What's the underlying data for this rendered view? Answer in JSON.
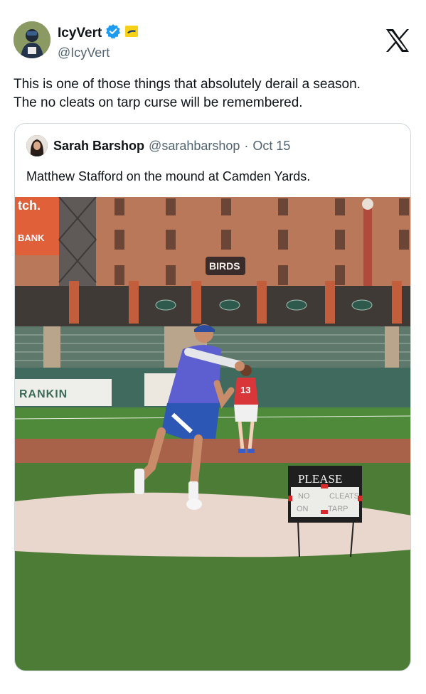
{
  "tweet": {
    "author": {
      "display_name": "IcyVert",
      "handle": "@IcyVert",
      "verified_icon": "verified-badge-icon",
      "affiliate_icon": "affiliate-badge-icon"
    },
    "text_lines": [
      "This is one of those things that absolutely derail a season.",
      "The no cleats on tarp curse will be remembered."
    ],
    "platform_icon": "x-logo-icon"
  },
  "quoted_tweet": {
    "author": {
      "display_name": "Sarah Barshop",
      "handle": "@sarahbarshop",
      "separator": "·",
      "date": "Oct 15"
    },
    "text": "Matthew Stafford on the mound at Camden Yards."
  },
  "photo": {
    "stadium_sign_left": "tch.",
    "stadium_sign_bank": "BANK",
    "scoreboard_sign": "BIRDS",
    "outfield_sign": "RANKIN",
    "player_number": "13",
    "tarp_sign": {
      "line1": "PLEASE",
      "line2_left": "NO",
      "line2_right": "CLEATS",
      "line3_left": "ON",
      "line3_right": "TARP"
    }
  },
  "colors": {
    "verified": "#1d9bf0",
    "affiliate_badge": "#f7d117",
    "text_secondary": "#536471",
    "border": "#cfd9de"
  }
}
